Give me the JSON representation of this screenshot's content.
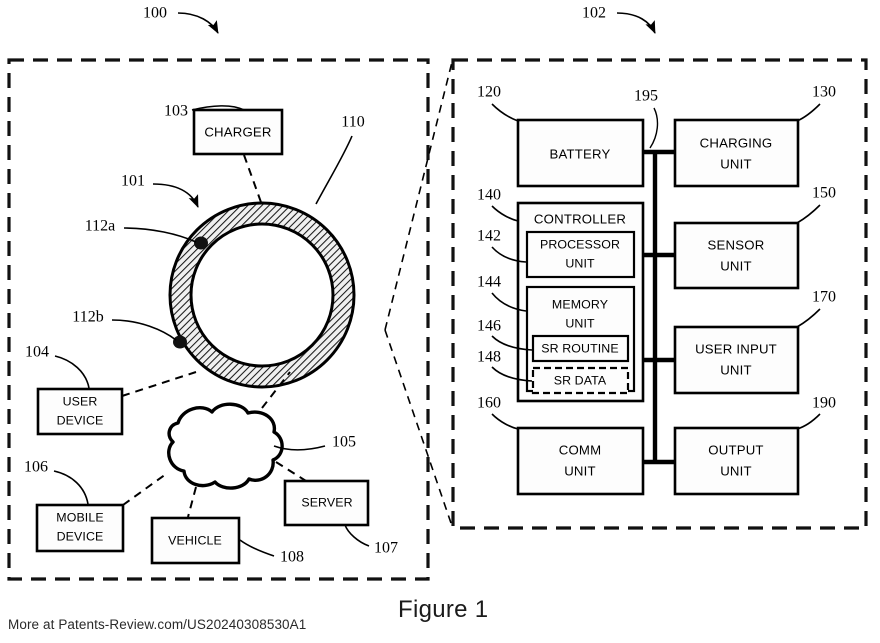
{
  "figure": {
    "caption": "Figure 1",
    "footer_credit": "More at Patents-Review.com/US20240308530A1"
  },
  "left_panel": {
    "ref": "100",
    "ring_device": {
      "ref_ring_body": "101",
      "ref_outer_surface": "110",
      "ref_contact_a": "112a",
      "ref_contact_b": "112b"
    },
    "blocks": [
      {
        "ref": "103",
        "label": "CHARGER"
      },
      {
        "ref": "104",
        "label_line1": "USER",
        "label_line2": "DEVICE"
      },
      {
        "ref": "106",
        "label_line1": "MOBILE",
        "label_line2": "DEVICE"
      },
      {
        "ref": "108",
        "label": "VEHICLE"
      },
      {
        "ref": "107",
        "label": "SERVER"
      }
    ],
    "network": {
      "ref": "105",
      "label": ""
    }
  },
  "right_panel": {
    "ref": "102",
    "bus_ref": "195",
    "blocks": [
      {
        "ref": "120",
        "label": "BATTERY"
      },
      {
        "ref": "130",
        "label_line1": "CHARGING",
        "label_line2": "UNIT"
      },
      {
        "ref": "140",
        "label": "CONTROLLER"
      },
      {
        "ref": "142",
        "label_line1": "PROCESSOR",
        "label_line2": "UNIT"
      },
      {
        "ref": "144",
        "label_line1": "MEMORY",
        "label_line2": "UNIT"
      },
      {
        "ref": "146",
        "label": "SR ROUTINE"
      },
      {
        "ref": "148",
        "label": "SR DATA"
      },
      {
        "ref": "150",
        "label_line1": "SENSOR",
        "label_line2": "UNIT"
      },
      {
        "ref": "160",
        "label_line1": "COMM",
        "label_line2": "UNIT"
      },
      {
        "ref": "170",
        "label_line1": "USER INPUT",
        "label_line2": "UNIT"
      },
      {
        "ref": "190",
        "label_line1": "OUTPUT",
        "label_line2": "UNIT"
      }
    ]
  },
  "colors": {
    "ink": "#000000",
    "paper": "#ffffff"
  }
}
